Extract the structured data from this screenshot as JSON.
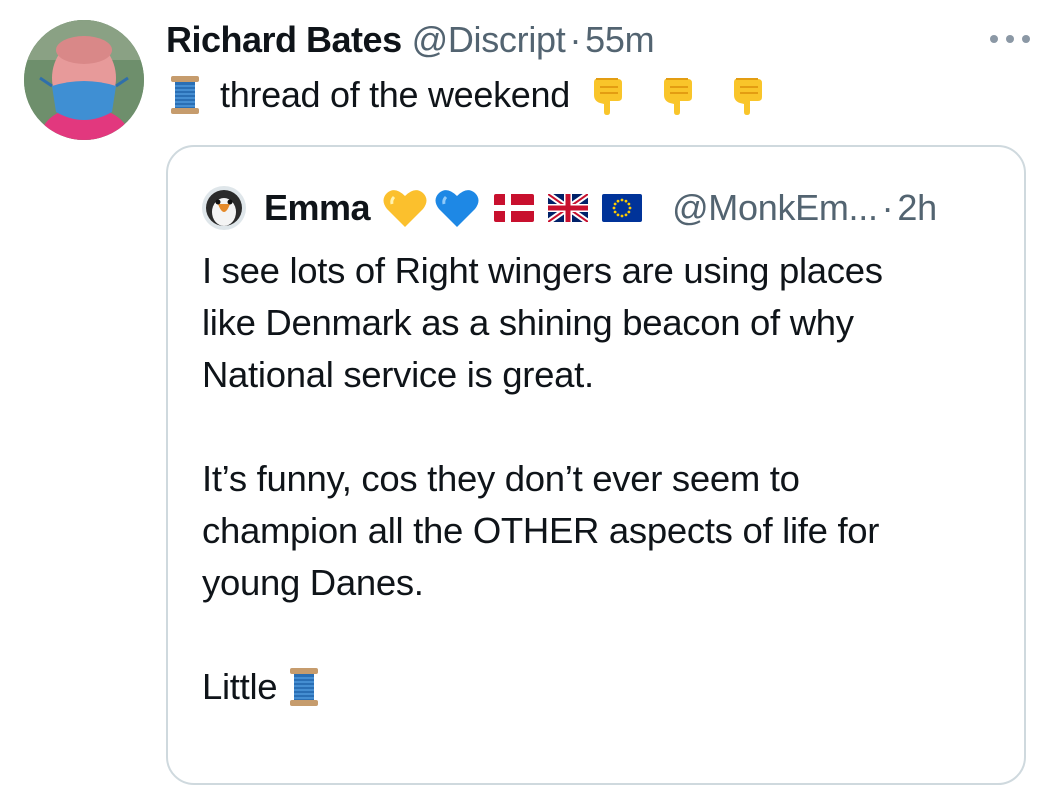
{
  "tweet": {
    "author_name": "Richard Bates",
    "author_handle": "@Discript",
    "separator": "·",
    "time": "55m",
    "text": "thread of the weekend",
    "leading_emoji": "spool-of-thread",
    "trailing_emojis": [
      "backhand-index-pointing-down",
      "backhand-index-pointing-down",
      "backhand-index-pointing-down"
    ]
  },
  "quoted_tweet": {
    "author_name": "Emma",
    "author_handle": "@MonkEm...",
    "separator": "·",
    "time": "2h",
    "badges": [
      "yellow-heart",
      "blue-heart"
    ],
    "flags": [
      "denmark-flag",
      "united-kingdom-flag",
      "european-union-flag"
    ],
    "paragraphs": [
      [
        "I see lots of Right wingers are using places",
        "like Denmark as a shining beacon of why",
        "National service is great."
      ],
      [
        "It’s funny, cos they don’t ever seem to",
        "champion all the OTHER aspects of life for",
        "young Danes."
      ]
    ],
    "closing": "Little",
    "closing_emoji": "spool-of-thread"
  },
  "colors": {
    "text_primary": "#0f1419",
    "text_secondary": "#536471",
    "card_border": "#cfd9de",
    "more_dots": "#8b98a5"
  }
}
